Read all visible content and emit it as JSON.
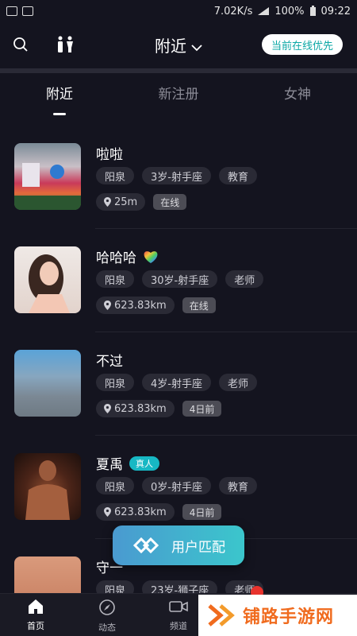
{
  "statusbar": {
    "speed": "7.02K/s",
    "battery": "100%",
    "time": "09:22"
  },
  "header": {
    "title": "附近",
    "online_button": "当前在线优先"
  },
  "tabs": [
    "附近",
    "新注册",
    "女神"
  ],
  "users": [
    {
      "name": "啦啦",
      "badge": "",
      "city": "阳泉",
      "age_sign": "3岁-射手座",
      "job": "教育",
      "distance": "25m",
      "status": "在线",
      "heart": false
    },
    {
      "name": "哈哈哈",
      "badge": "",
      "city": "阳泉",
      "age_sign": "30岁-射手座",
      "job": "老师",
      "distance": "623.83km",
      "status": "在线",
      "heart": true
    },
    {
      "name": "不过",
      "badge": "",
      "city": "阳泉",
      "age_sign": "4岁-射手座",
      "job": "老师",
      "distance": "623.83km",
      "status": "4日前",
      "heart": false
    },
    {
      "name": "夏禹",
      "badge": "真人",
      "city": "阳泉",
      "age_sign": "0岁-射手座",
      "job": "教育",
      "distance": "623.83km",
      "status": "4日前",
      "heart": false
    },
    {
      "name": "守一",
      "badge": "",
      "city": "阳泉",
      "age_sign": "23岁-狮子座",
      "job": "老师",
      "distance": "",
      "status": "",
      "heart": false
    }
  ],
  "match_button": "用户匹配",
  "nav": [
    {
      "label": "首页",
      "icon": "home-icon"
    },
    {
      "label": "动态",
      "icon": "compass-icon"
    },
    {
      "label": "频道",
      "icon": "video-icon"
    }
  ],
  "watermark": "铺路手游网",
  "colors": {
    "background": "#14141f",
    "accent": "#17b8c4",
    "watermark": "#f06b1e"
  }
}
